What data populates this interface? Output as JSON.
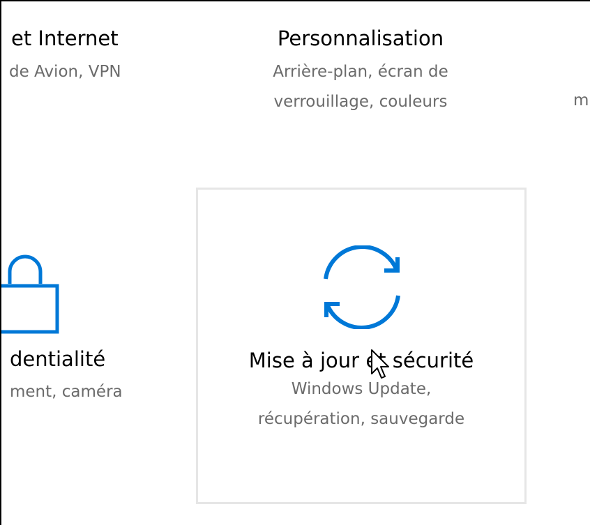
{
  "colors": {
    "accent": "#0078d7",
    "title_text": "#000000",
    "description_text": "#6b6b6b",
    "tile_hover_border": "#e6e6e6"
  },
  "tiles": {
    "network": {
      "title": "et Internet",
      "description": "de Avion, VPN"
    },
    "personalisation": {
      "title": "Personnalisation",
      "description_lines": [
        "Arrière-plan, écran de",
        "verrouillage, couleurs"
      ]
    },
    "right_partial": {
      "description": "m"
    },
    "privacy": {
      "icon": "lock-icon",
      "title": "dentialité",
      "description": "ment, caméra"
    },
    "update_security": {
      "icon": "sync-icon",
      "title": "Mise à jour et sécurité",
      "description_lines": [
        "Windows Update,",
        "récupération, sauvegarde"
      ],
      "state": "hover"
    }
  },
  "cursor": {
    "icon": "arrow-cursor-icon"
  }
}
